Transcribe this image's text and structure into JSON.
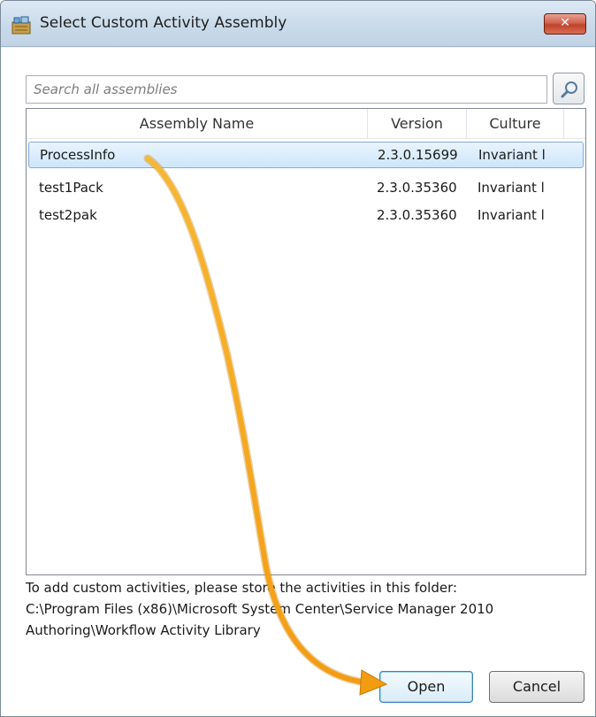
{
  "window": {
    "title": "Select Custom Activity Assembly",
    "close_glyph": "✕"
  },
  "search": {
    "placeholder": "Search all assemblies",
    "icon": "magnifier-icon"
  },
  "table": {
    "columns": [
      "Assembly Name",
      "Version",
      "Culture"
    ],
    "rows": [
      {
        "name": "ProcessInfo",
        "version": "2.3.0.15699",
        "culture": "Invariant l",
        "selected": true
      },
      {
        "name": "test1Pack",
        "version": "2.3.0.35360",
        "culture": "Invariant l",
        "selected": false
      },
      {
        "name": "test2pak",
        "version": "2.3.0.35360",
        "culture": "Invariant l",
        "selected": false
      }
    ]
  },
  "info": {
    "line1": "To add custom activities, please store the activities in this folder:",
    "line2": "C:\\Program Files (x86)\\Microsoft System Center\\Service Manager 2010",
    "line3": "Authoring\\Workflow Activity Library"
  },
  "buttons": {
    "open": "Open",
    "cancel": "Cancel"
  },
  "colors": {
    "selection": "#cde6fa",
    "annotation_arrow": "#f39c12",
    "close_button": "#c0422a"
  }
}
